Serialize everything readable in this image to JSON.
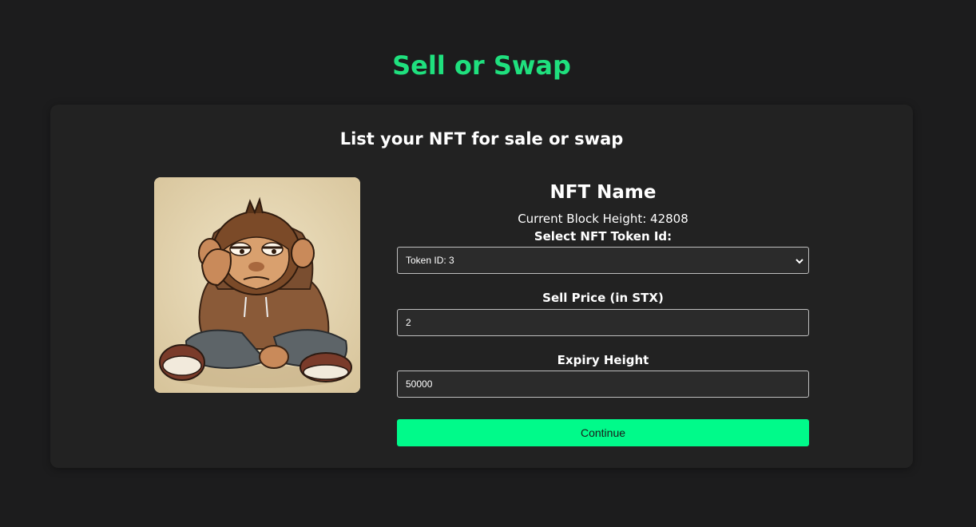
{
  "page": {
    "title": "Sell or Swap"
  },
  "card": {
    "title": "List your NFT for sale or swap"
  },
  "nft": {
    "name": "NFT Name",
    "block_height_text": "Current Block Height: 42808",
    "image_icon": "sad-monkey-in-hoodie-illustration"
  },
  "form": {
    "token_label": "Select NFT Token Id:",
    "token_selected": "Token ID: 3",
    "price_label": "Sell Price (in STX)",
    "price_value": "2",
    "expiry_label": "Expiry Height",
    "expiry_value": "50000",
    "continue_label": "Continue"
  },
  "colors": {
    "background": "#1c1c1d",
    "card": "#222222",
    "accent_title": "#1fe07e",
    "button": "#00fa8a"
  }
}
